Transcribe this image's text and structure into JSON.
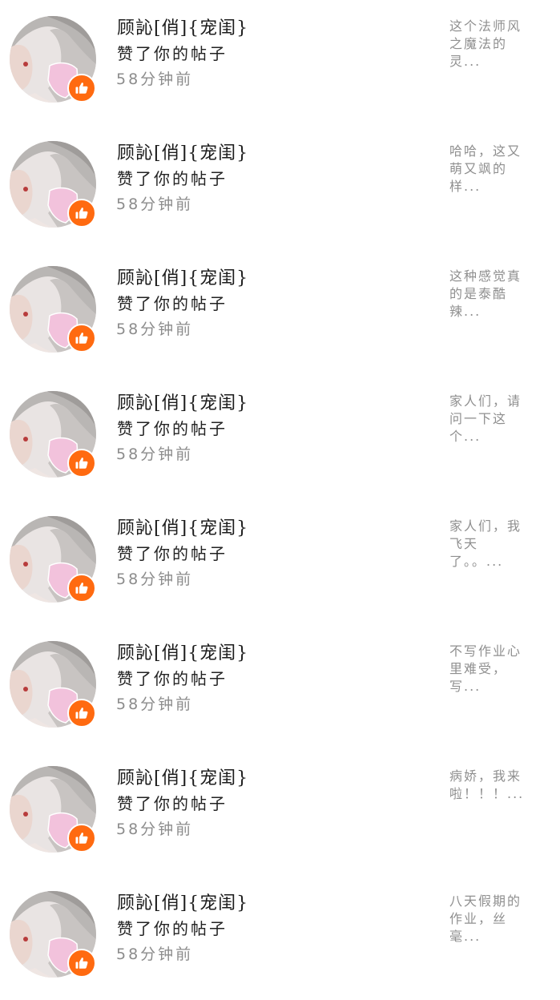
{
  "colors": {
    "like_badge": "#ff6a10",
    "username_text": "#1c1c1c",
    "time_text": "#8c8c8c",
    "snippet_text": "#8f8f8f",
    "background": "#ffffff"
  },
  "icons": {
    "avatar": "anime-avatar-image",
    "badge": "thumbs-up-icon"
  },
  "notifications": [
    {
      "username": "顾訫[俏]{宠闺}",
      "action": "赞了你的帖子",
      "time": "58分钟前",
      "snippet": "这个法师风之魔法的灵..."
    },
    {
      "username": "顾訫[俏]{宠闺}",
      "action": "赞了你的帖子",
      "time": "58分钟前",
      "snippet": "哈哈，这又萌又飒的样..."
    },
    {
      "username": "顾訫[俏]{宠闺}",
      "action": "赞了你的帖子",
      "time": "58分钟前",
      "snippet": "这种感觉真的是泰酷辣..."
    },
    {
      "username": "顾訫[俏]{宠闺}",
      "action": "赞了你的帖子",
      "time": "58分钟前",
      "snippet": "家人们，请问一下这个..."
    },
    {
      "username": "顾訫[俏]{宠闺}",
      "action": "赞了你的帖子",
      "time": "58分钟前",
      "snippet": "家人们，我飞天了。。..."
    },
    {
      "username": "顾訫[俏]{宠闺}",
      "action": "赞了你的帖子",
      "time": "58分钟前",
      "snippet": "不写作业心里难受，写..."
    },
    {
      "username": "顾訫[俏]{宠闺}",
      "action": "赞了你的帖子",
      "time": "58分钟前",
      "snippet": "病娇，我来啦！！！..."
    },
    {
      "username": "顾訫[俏]{宠闺}",
      "action": "赞了你的帖子",
      "time": "58分钟前",
      "snippet": "八天假期的作业，丝毫..."
    }
  ]
}
